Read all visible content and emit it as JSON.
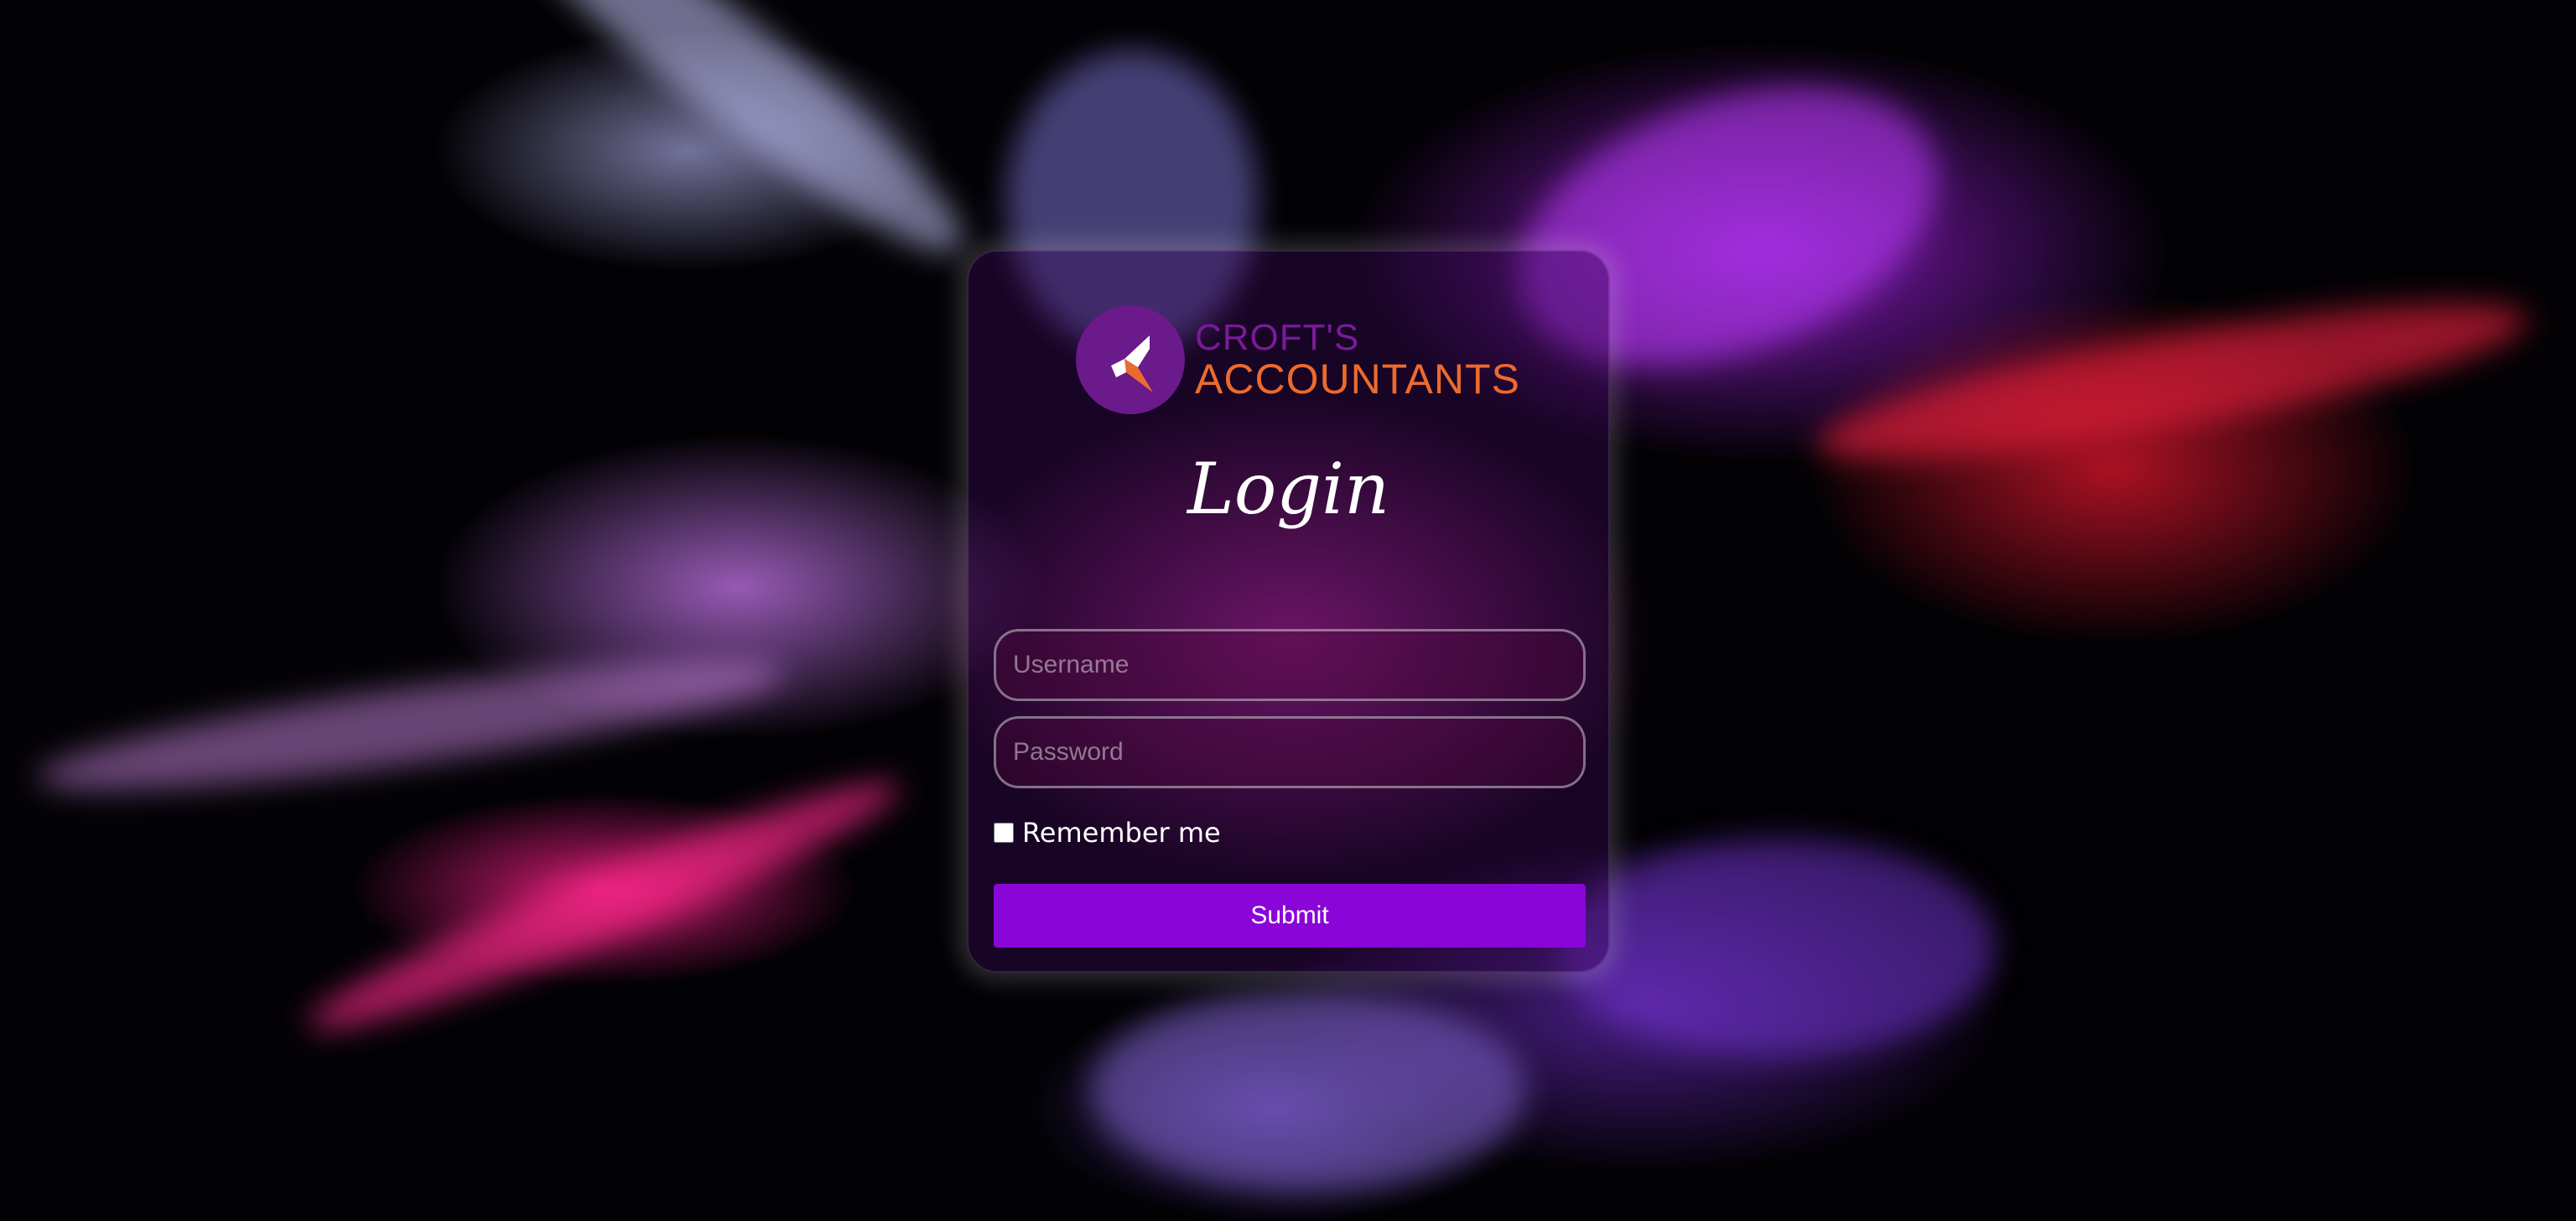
{
  "brand": {
    "line1": "CROFT'S",
    "line2": "ACCOUNTANTS",
    "mark_color": "#6a1a8a",
    "line1_color": "#7a1a9a",
    "line2_color": "#ec6a2e"
  },
  "login": {
    "title": "Login",
    "username_placeholder": "Username",
    "password_placeholder": "Password",
    "remember_label": "Remember me",
    "submit_label": "Submit",
    "accent": "#8a05d8"
  },
  "background": {
    "description_icon": "color-powder-explosion"
  }
}
